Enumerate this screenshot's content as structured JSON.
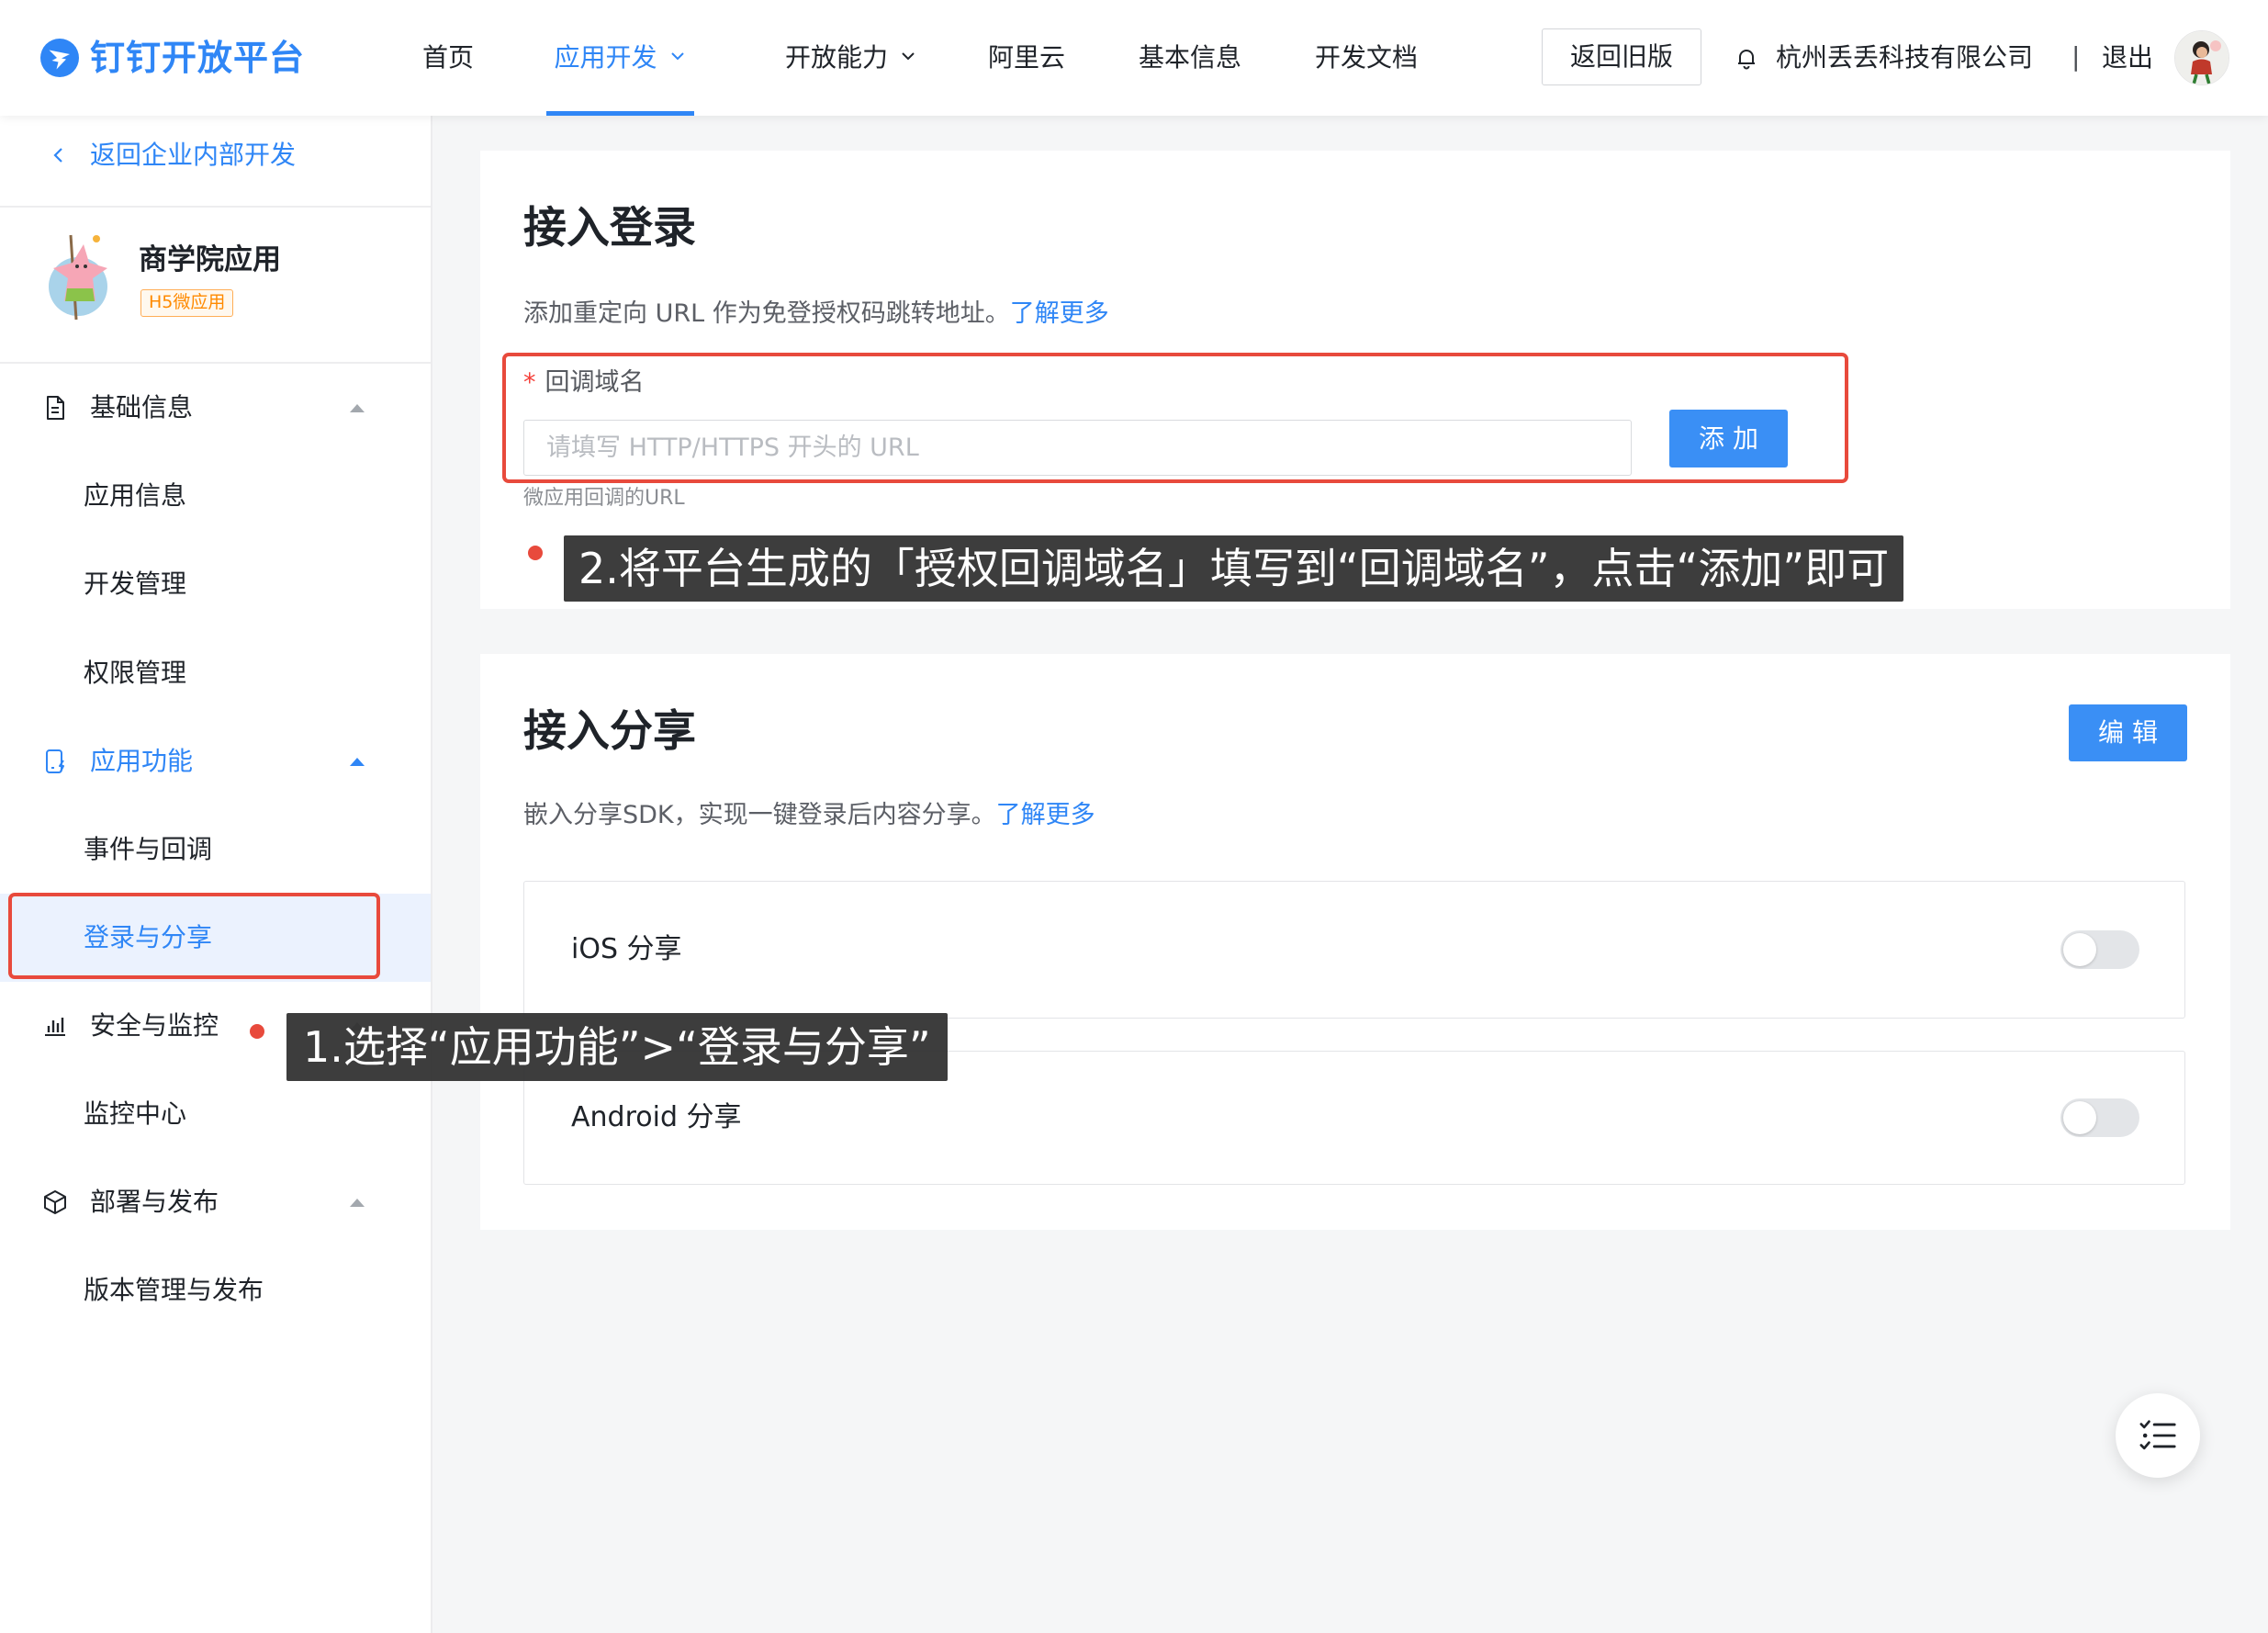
{
  "colors": {
    "accent": "#2f86f6",
    "accent_button": "#3a8ff5",
    "annotation_red": "#e84a3c",
    "annotation_bg": "#3b3b3b",
    "selected_bg": "#ebf2fe",
    "page_bg": "#f5f6f7",
    "tag_orange": "#ff8a00"
  },
  "icons": {
    "logo": "dingtalk-logo-icon",
    "nav_dropdown": "chevron-down-icon",
    "notifications": "bell-icon",
    "back": "chevron-left-icon",
    "group_expanded": "caret-up-icon",
    "floating_menu": "checklist-icon"
  },
  "header": {
    "logo_text": "钉钉开放平台",
    "nav": [
      {
        "label": "首页",
        "active": false,
        "has_dropdown": false
      },
      {
        "label": "应用开发",
        "active": true,
        "has_dropdown": true
      },
      {
        "label": "开放能力",
        "active": false,
        "has_dropdown": true
      },
      {
        "label": "阿里云",
        "active": false,
        "has_dropdown": false
      },
      {
        "label": "基本信息",
        "active": false,
        "has_dropdown": false
      },
      {
        "label": "开发文档",
        "active": false,
        "has_dropdown": false
      }
    ],
    "old_version_button": "返回旧版",
    "company_name": "杭州丢丢科技有限公司",
    "separator": "|",
    "logout": "退出"
  },
  "sidebar": {
    "back_link": "返回企业内部开发",
    "app": {
      "name": "商学院应用",
      "tag": "H5微应用"
    },
    "groups": [
      {
        "label": "基础信息",
        "icon": "document-icon",
        "expanded": true,
        "active": false,
        "items": [
          {
            "label": "应用信息"
          },
          {
            "label": "开发管理"
          },
          {
            "label": "权限管理"
          }
        ]
      },
      {
        "label": "应用功能",
        "icon": "device-bolt-icon",
        "expanded": true,
        "active": true,
        "items": [
          {
            "label": "事件与回调"
          },
          {
            "label": "登录与分享",
            "selected": true
          }
        ]
      },
      {
        "label": "安全与监控",
        "icon": "bar-chart-icon",
        "expanded": true,
        "active": false,
        "items": [
          {
            "label": "监控中心"
          }
        ]
      },
      {
        "label": "部署与发布",
        "icon": "cube-icon",
        "expanded": true,
        "active": false,
        "items": [
          {
            "label": "版本管理与发布"
          }
        ]
      }
    ]
  },
  "login_card": {
    "title": "接入登录",
    "description": "添加重定向 URL 作为免登授权码跳转地址。",
    "learn_more": "了解更多",
    "required_mark": "*",
    "field_label": "回调域名",
    "input_placeholder": "请填写 HTTP/HTTPS 开头的 URL",
    "add_button": "添 加",
    "helper_text": "微应用回调的URL"
  },
  "share_card": {
    "title": "接入分享",
    "edit_button": "编 辑",
    "description": "嵌入分享SDK，实现一键登录后内容分享。",
    "learn_more": "了解更多",
    "options": [
      {
        "label": "iOS 分享",
        "enabled": false
      },
      {
        "label": "Android 分享",
        "enabled": false
      }
    ]
  },
  "annotations": {
    "step1": "1.选择“应用功能”>“登录与分享”",
    "step2": "2.将平台生成的「授权回调域名」填写到“回调域名”，点击“添加”即可"
  }
}
